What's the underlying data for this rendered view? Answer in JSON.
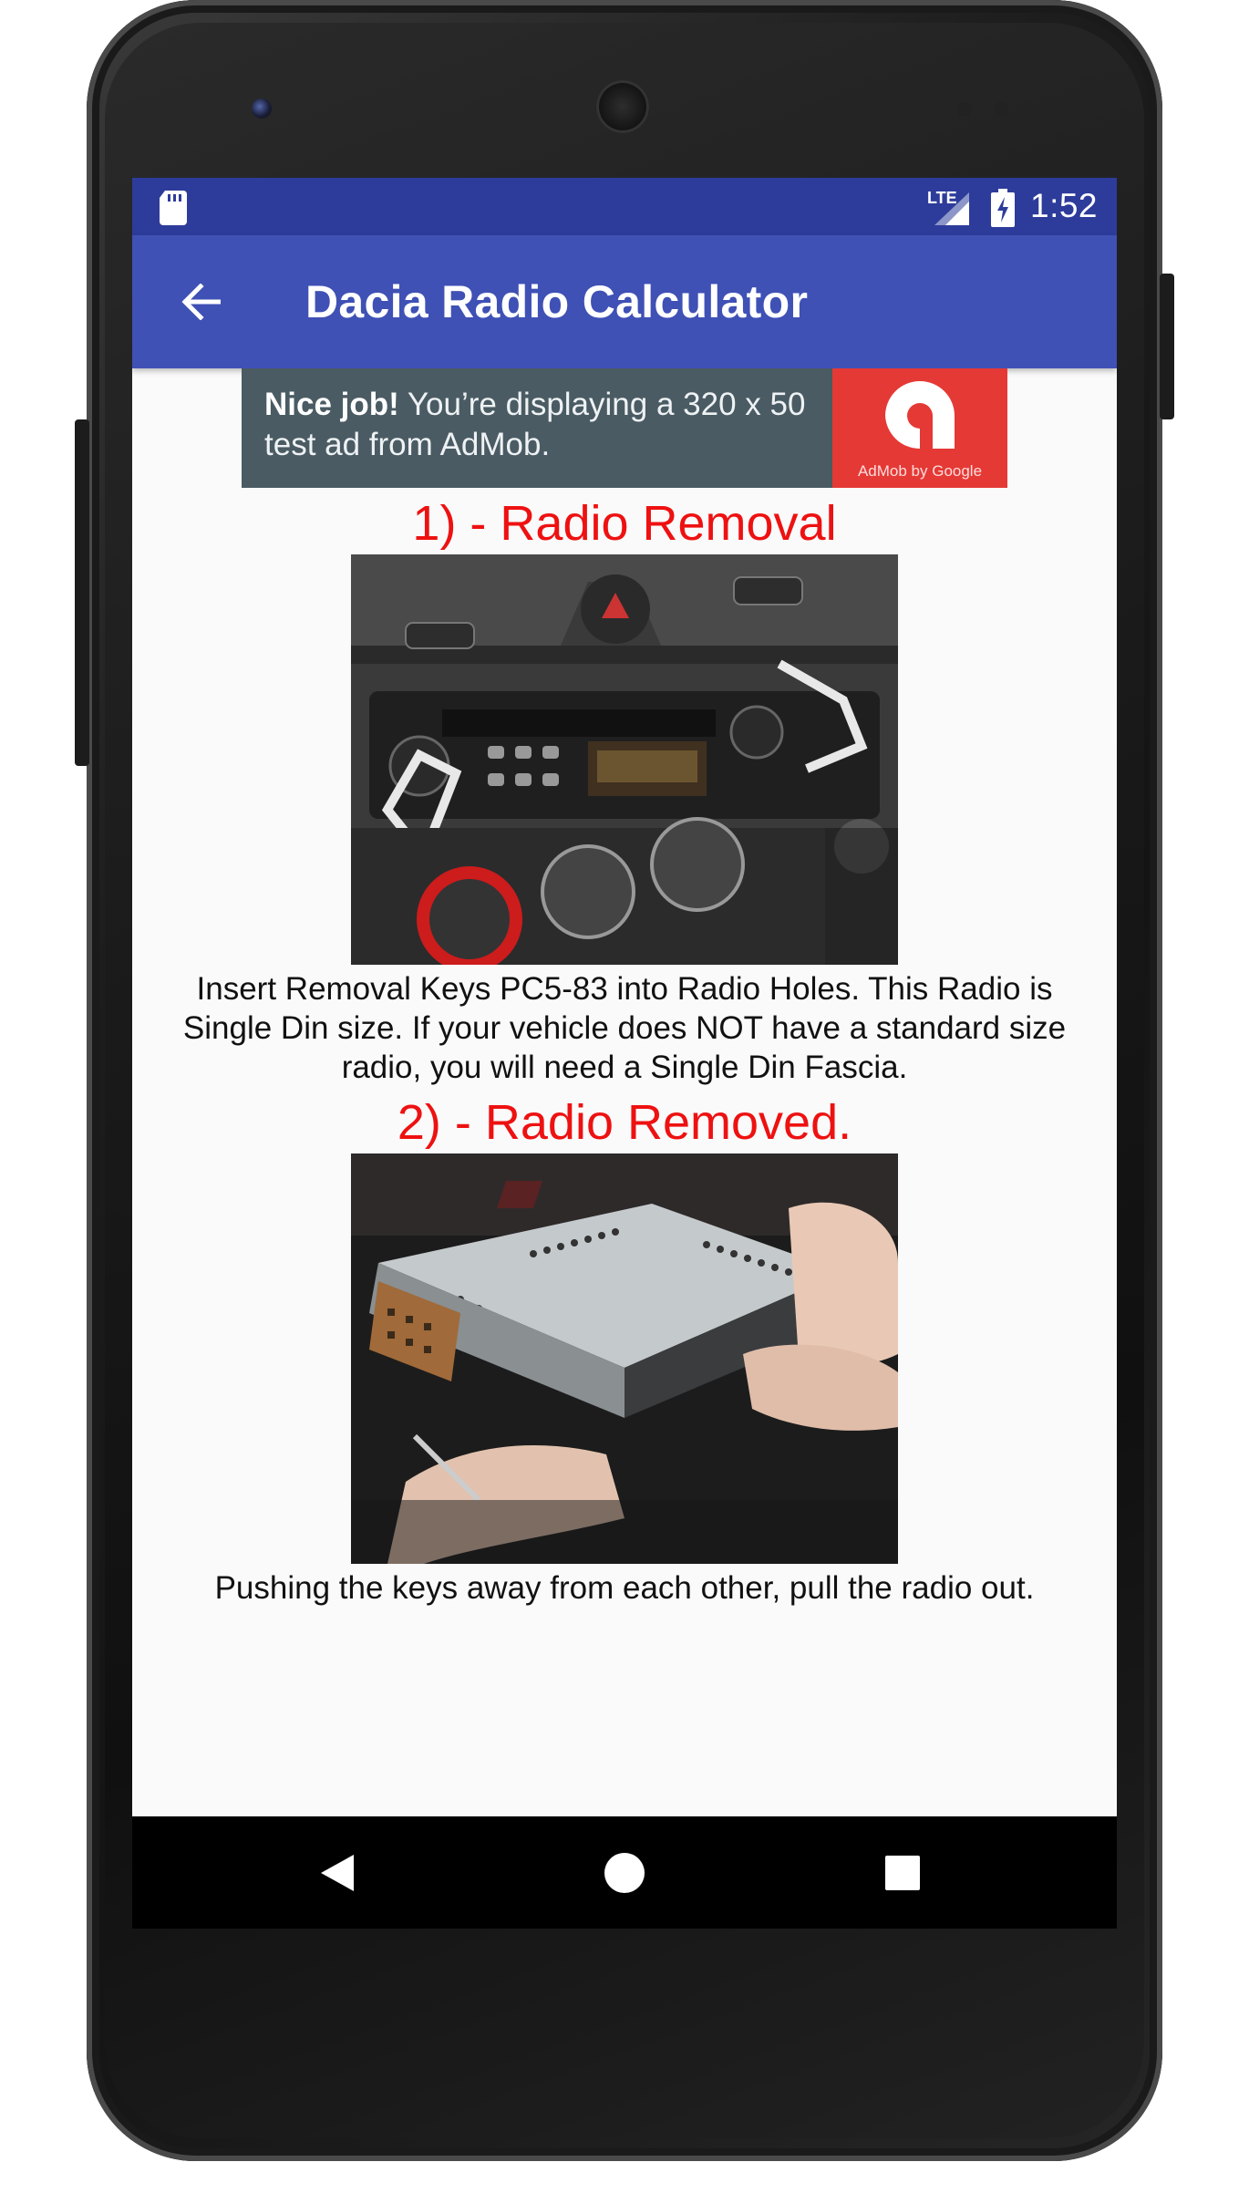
{
  "status_bar": {
    "network": "LTE",
    "time": "1:52"
  },
  "app_bar": {
    "title": "Dacia Radio Calculator"
  },
  "ad": {
    "bold_text": "Nice job!",
    "text": " You’re displaying a 320 x 50 test ad from AdMob.",
    "logo_caption": "AdMob by Google"
  },
  "sections": [
    {
      "title": "1) - Radio Removal",
      "caption": "Insert Removal Keys PC5-83 into Radio Holes. This Radio is Single Din size. If your vehicle does NOT have a standard size radio, you will need a Single Din Fascia."
    },
    {
      "title": "2) - Radio Removed.",
      "caption": "Pushing the keys away from each other, pull the radio out."
    }
  ],
  "colors": {
    "status_bar": "#2d3c9b",
    "app_bar": "#3f51b5",
    "section_title": "#ee1111",
    "ad_background": "#4a5b63",
    "ad_logo": "#e53935"
  }
}
